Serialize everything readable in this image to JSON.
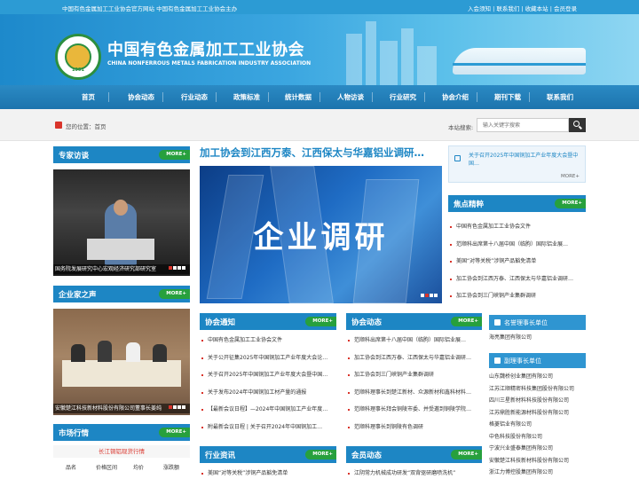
{
  "topbar": {
    "left_text": "中国有色金属加工工业协会官方网站 中国有色金属加工工业协会主办",
    "links": [
      "入会须知",
      "联系我们",
      "收藏本站",
      "会员登录"
    ]
  },
  "header": {
    "title": "中国有色金属加工工业协会",
    "subtitle": "CHINA NONFERROUS METALS FABRICATION INDUSTRY ASSOCIATION",
    "logo_year": "1991"
  },
  "nav": [
    "首页",
    "协会动态",
    "行业动态",
    "政策标准",
    "统计数据",
    "人物访谈",
    "行业研究",
    "协会介绍",
    "期刊下载",
    "联系我们"
  ],
  "location": {
    "prefix": "您的位置：",
    "current": "首页"
  },
  "search": {
    "label": "本站搜索:",
    "placeholder": "输入关键字搜索"
  },
  "more_label": "MORE+",
  "sections": {
    "expert": {
      "title": "专家访谈",
      "caption": "国务院发展研究中心宏观经济研究部研究室"
    },
    "entrepreneur": {
      "title": "企业家之声",
      "caption": "安徽楚江科技新材料股份有限公司董事长姜纯"
    },
    "market": {
      "title": "市场行情",
      "caption": "长江铜铝现货行情",
      "columns": [
        "品名",
        "价格区间",
        "均价",
        "涨跌额"
      ]
    },
    "headline": {
      "title": "加工协会到江西万泰、江西保太与华嘉铝业调研…",
      "hero_word": "企业调研"
    },
    "notice_top": {
      "text": "关于召开2025年中国铜加工产业年度大会暨中国…",
      "more": "MORE+"
    },
    "focus": {
      "title": "焦点精粹",
      "items": [
        "中国有色金属加工工业协会文件",
        "范顺科出席第十八届中国（临朐）国际铝业展…",
        "美国“对等关税”涉铜产品豁免清单",
        "加工协会到江西万泰、江西保太与华嘉铝业调研…",
        "加工协会到三门峡铜产业集群调研"
      ]
    },
    "association_notice": {
      "title": "协会通知",
      "items": [
        "中国有色金属加工工业协会文件",
        "关于公开征集2025年中国铜加工产业年度大会论…",
        "关于召开2025年中国铜加工产业年度大会暨中国…",
        "关于发布2024年中国铜加工材产量的通报",
        "【最新会议日程】—2024年中国铜加工产业年度…",
        "附最新会议日程 | 关于召开2024年中国铜加工…"
      ]
    },
    "association_news": {
      "title": "协会动态",
      "items": [
        "范顺科出席第十八届中国（临朐）国际铝业展…",
        "加工协会到江西万泰、江西保太与华嘉铝业调研…",
        "加工协会到三门峡铜产业集群调研",
        "范顺科理事长到楚江新材、众源新材和鑫科材料…",
        "范顺科理事长拜会铜陵市委、并受邀到铜陵学院…",
        "范顺科理事长到铜陵有色调研"
      ]
    },
    "industry_info": {
      "title": "行业资讯",
      "items": [
        "美国“对等关税”涉铜产品豁免清单"
      ]
    },
    "member_news": {
      "title": "会员动态",
      "items": [
        "江阴常力机械成功研发“双背驱研磨喷洗机”"
      ]
    },
    "president_units": {
      "title": "名誉理事长单位",
      "items": [
        "海亮集团有限公司"
      ]
    },
    "vice_president_units": {
      "title": "副理事长单位",
      "items": [
        "山东魏桥创业集团有限公司",
        "江苏江顺精密科技集团股份有限公司",
        "四川三星新材料科技股份有限公司",
        "江苏鼎胜新能源材料股份有限公司",
        "格菱铝业有限公司",
        "中色科技股份有限公司",
        "宁波兴业盛泰集团有限公司",
        "安徽楚江科技新材料股份有限公司",
        "浙江力博控股集团有限公司"
      ]
    }
  },
  "colors": {
    "primary_blue": "#1d86c4",
    "more_green": "#27a03d",
    "accent_red": "#d9342b"
  }
}
